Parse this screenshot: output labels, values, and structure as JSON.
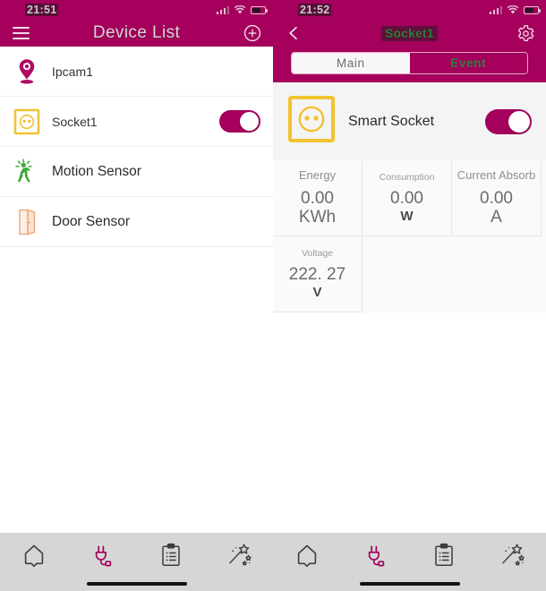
{
  "left": {
    "statusbar": {
      "clock": "21:51",
      "signal_icon": "signal-bars-icon",
      "wifi_icon": "wifi-icon",
      "battery_icon": "battery-icon"
    },
    "navbar": {
      "menu_icon": "hamburger-menu-icon",
      "title": "Device List",
      "add_icon": "plus-circle-icon"
    },
    "devices": [
      {
        "name": "Ipcam1",
        "icon": "ipcamera-icon",
        "has_toggle": false
      },
      {
        "name": "Socket1",
        "icon": "socket-icon",
        "has_toggle": true,
        "toggle_state": "on"
      },
      {
        "name": "Motion Sensor",
        "icon": "motion-sensor-icon",
        "has_toggle": false
      },
      {
        "name": "Door Sensor",
        "icon": "door-sensor-icon",
        "has_toggle": false
      }
    ],
    "bottomnav": {
      "items": [
        {
          "icon": "home-icon",
          "active": false
        },
        {
          "icon": "plug-icon",
          "active": true
        },
        {
          "icon": "clipboard-list-icon",
          "active": false
        },
        {
          "icon": "magic-wand-icon",
          "active": false
        }
      ]
    }
  },
  "right": {
    "statusbar": {
      "clock": "21:52",
      "signal_icon": "signal-bars-icon",
      "wifi_icon": "wifi-icon",
      "battery_icon": "battery-icon"
    },
    "navbar": {
      "back_icon": "chevron-left-icon",
      "title": "Socket1",
      "settings_icon": "gear-icon"
    },
    "tabs": [
      {
        "label": "Main",
        "selected": true
      },
      {
        "label": "Event",
        "selected": false
      }
    ],
    "device_card": {
      "icon": "socket-icon",
      "name": "Smart Socket",
      "toggle_state": "on"
    },
    "metrics": [
      {
        "key": "Energy",
        "value": "0.00",
        "unit": "KWh"
      },
      {
        "key": "Consumption",
        "value": "0.00",
        "unit": "W"
      },
      {
        "key": "Current Absorb",
        "value": "0.00",
        "unit": "A"
      },
      {
        "key": "Voltage",
        "value": "222. 27",
        "unit": "V"
      }
    ],
    "bottomnav": {
      "items": [
        {
          "icon": "home-icon",
          "active": false
        },
        {
          "icon": "plug-icon",
          "active": true
        },
        {
          "icon": "clipboard-list-icon",
          "active": false
        },
        {
          "icon": "magic-wand-icon",
          "active": false
        }
      ]
    }
  },
  "colors": {
    "brand_magenta": "#a4005c",
    "socket_yellow": "#f2c230",
    "motion_green": "#3ba936",
    "door_peach": "#f3b98f",
    "navbar_gray": "#d6d6d6",
    "tab_green": "#2f7d3a"
  }
}
